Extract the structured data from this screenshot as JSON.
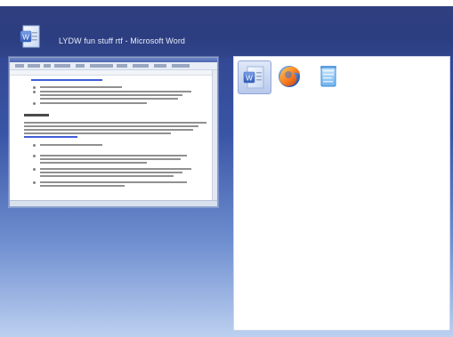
{
  "window": {
    "title": "LYDW fun stuff rtf - Microsoft Word",
    "app_icon": "word-document-icon"
  },
  "taskbar": {
    "items": [
      {
        "label": "Word document",
        "icon": "word-document-icon",
        "selected": true
      },
      {
        "label": "Firefox",
        "icon": "firefox-icon",
        "selected": false
      },
      {
        "label": "Notepad",
        "icon": "notepad-icon",
        "selected": false
      }
    ]
  },
  "colors": {
    "background_top": "#2d3f86",
    "background_bottom": "#bcd0f0",
    "header": "#2f3f7f",
    "panel": "#ffffff",
    "selected_tile": "#b8c8ea"
  }
}
